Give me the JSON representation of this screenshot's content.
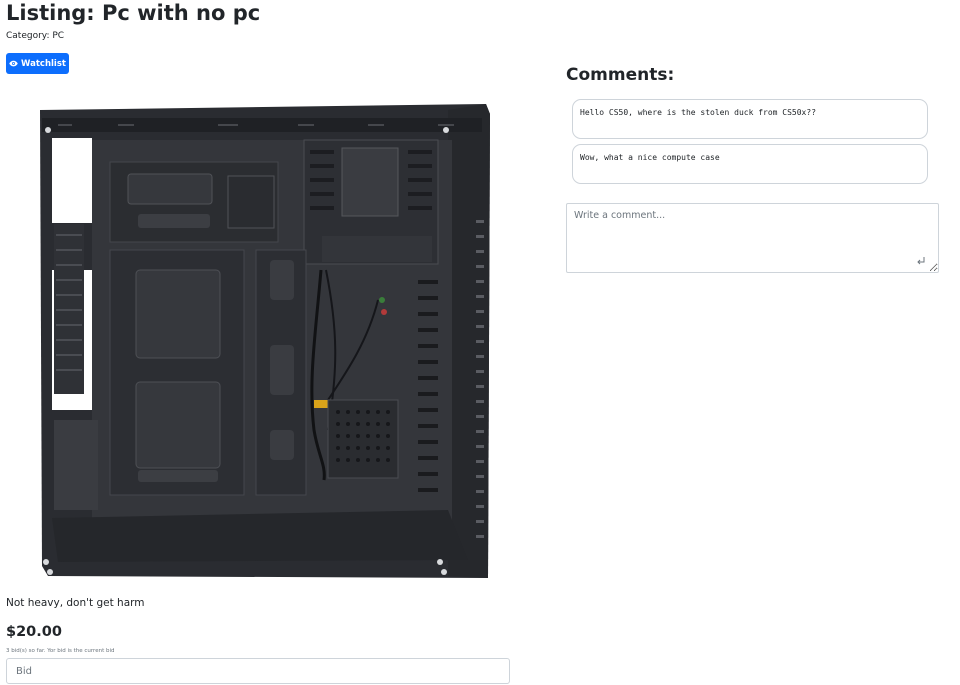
{
  "listing": {
    "title": "Listing: Pc with no pc",
    "category": "Category: PC",
    "watchlist_label": "Watchlist",
    "image_alt": "computer-case",
    "description": "Not heavy, don't get harm",
    "price": "$20.00",
    "bid_info": "3 bid(s) so far. Yor bid is the current bid",
    "bid_placeholder": "Bid"
  },
  "comments": {
    "heading": "Comments:",
    "items": [
      {
        "text": "Hello CS50, where is the stolen duck from CS50x??"
      },
      {
        "text": "Wow, what a nice compute case"
      }
    ],
    "input_placeholder": "Write a comment..."
  },
  "icons": {
    "watchlist": "eye-icon",
    "comment_submit": "enter-return-icon"
  },
  "colors": {
    "primary": "#0d6efd",
    "border": "#ced4da",
    "muted": "#6c757d",
    "text": "#212529"
  }
}
